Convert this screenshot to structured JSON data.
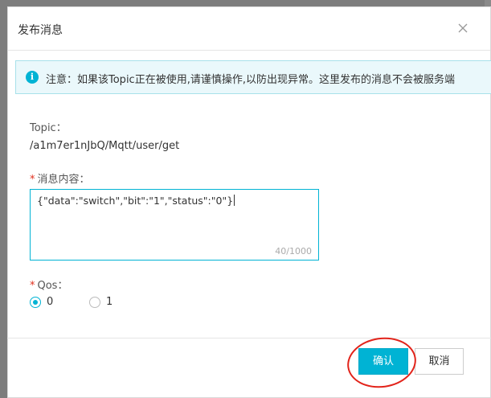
{
  "dialog": {
    "title": "发布消息",
    "close_icon": "close-icon"
  },
  "notice": {
    "icon": "info-icon",
    "text": "注意：如果该Topic正在被使用,请谨慎操作,以防出现异常。这里发布的消息不会被服务端"
  },
  "topic": {
    "label": "Topic：",
    "value": "/a1m7er1nJbQ/Mqtt/user/get"
  },
  "message": {
    "required_mark": "*",
    "label": "消息内容：",
    "value": "{\"data\":\"switch\",\"bit\":\"1\",\"status\":\"0\"}",
    "counter": "40/1000"
  },
  "qos": {
    "required_mark": "*",
    "label": "Qos：",
    "options": [
      {
        "label": "0",
        "checked": true
      },
      {
        "label": "1",
        "checked": false
      }
    ]
  },
  "footer": {
    "confirm_label": "确认",
    "cancel_label": "取消"
  },
  "colors": {
    "accent": "#00b3d4",
    "required": "#e0301e",
    "annotation": "#e2231a"
  }
}
